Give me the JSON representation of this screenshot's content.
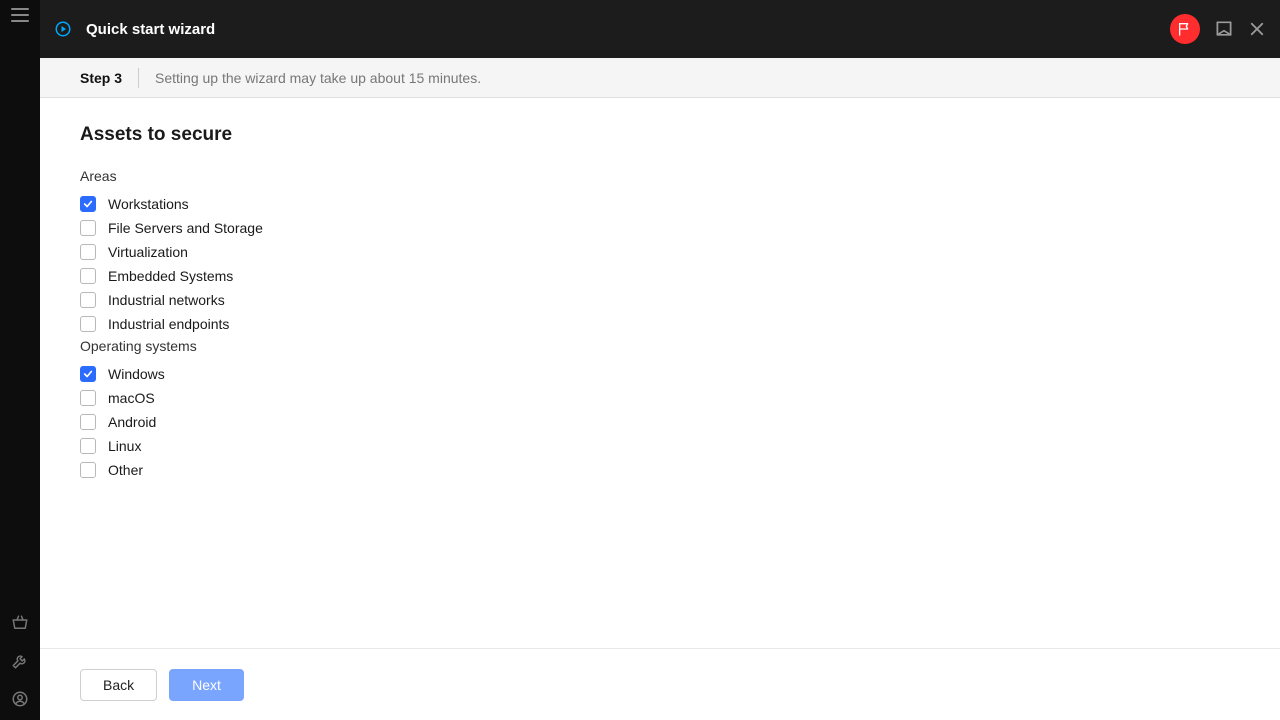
{
  "header": {
    "title": "Quick start wizard"
  },
  "stepbar": {
    "step": "Step 3",
    "subtitle": "Setting up the wizard may take up about 15 minutes."
  },
  "content": {
    "title": "Assets to secure",
    "areas_label": "Areas",
    "areas": [
      {
        "label": "Workstations",
        "checked": true
      },
      {
        "label": "File Servers and Storage",
        "checked": false
      },
      {
        "label": "Virtualization",
        "checked": false
      },
      {
        "label": "Embedded Systems",
        "checked": false
      },
      {
        "label": "Industrial networks",
        "checked": false
      },
      {
        "label": "Industrial endpoints",
        "checked": false
      }
    ],
    "os_label": "Operating systems",
    "os": [
      {
        "label": "Windows",
        "checked": true
      },
      {
        "label": "macOS",
        "checked": false
      },
      {
        "label": "Android",
        "checked": false
      },
      {
        "label": "Linux",
        "checked": false
      },
      {
        "label": "Other",
        "checked": false
      }
    ]
  },
  "footer": {
    "back": "Back",
    "next": "Next"
  }
}
